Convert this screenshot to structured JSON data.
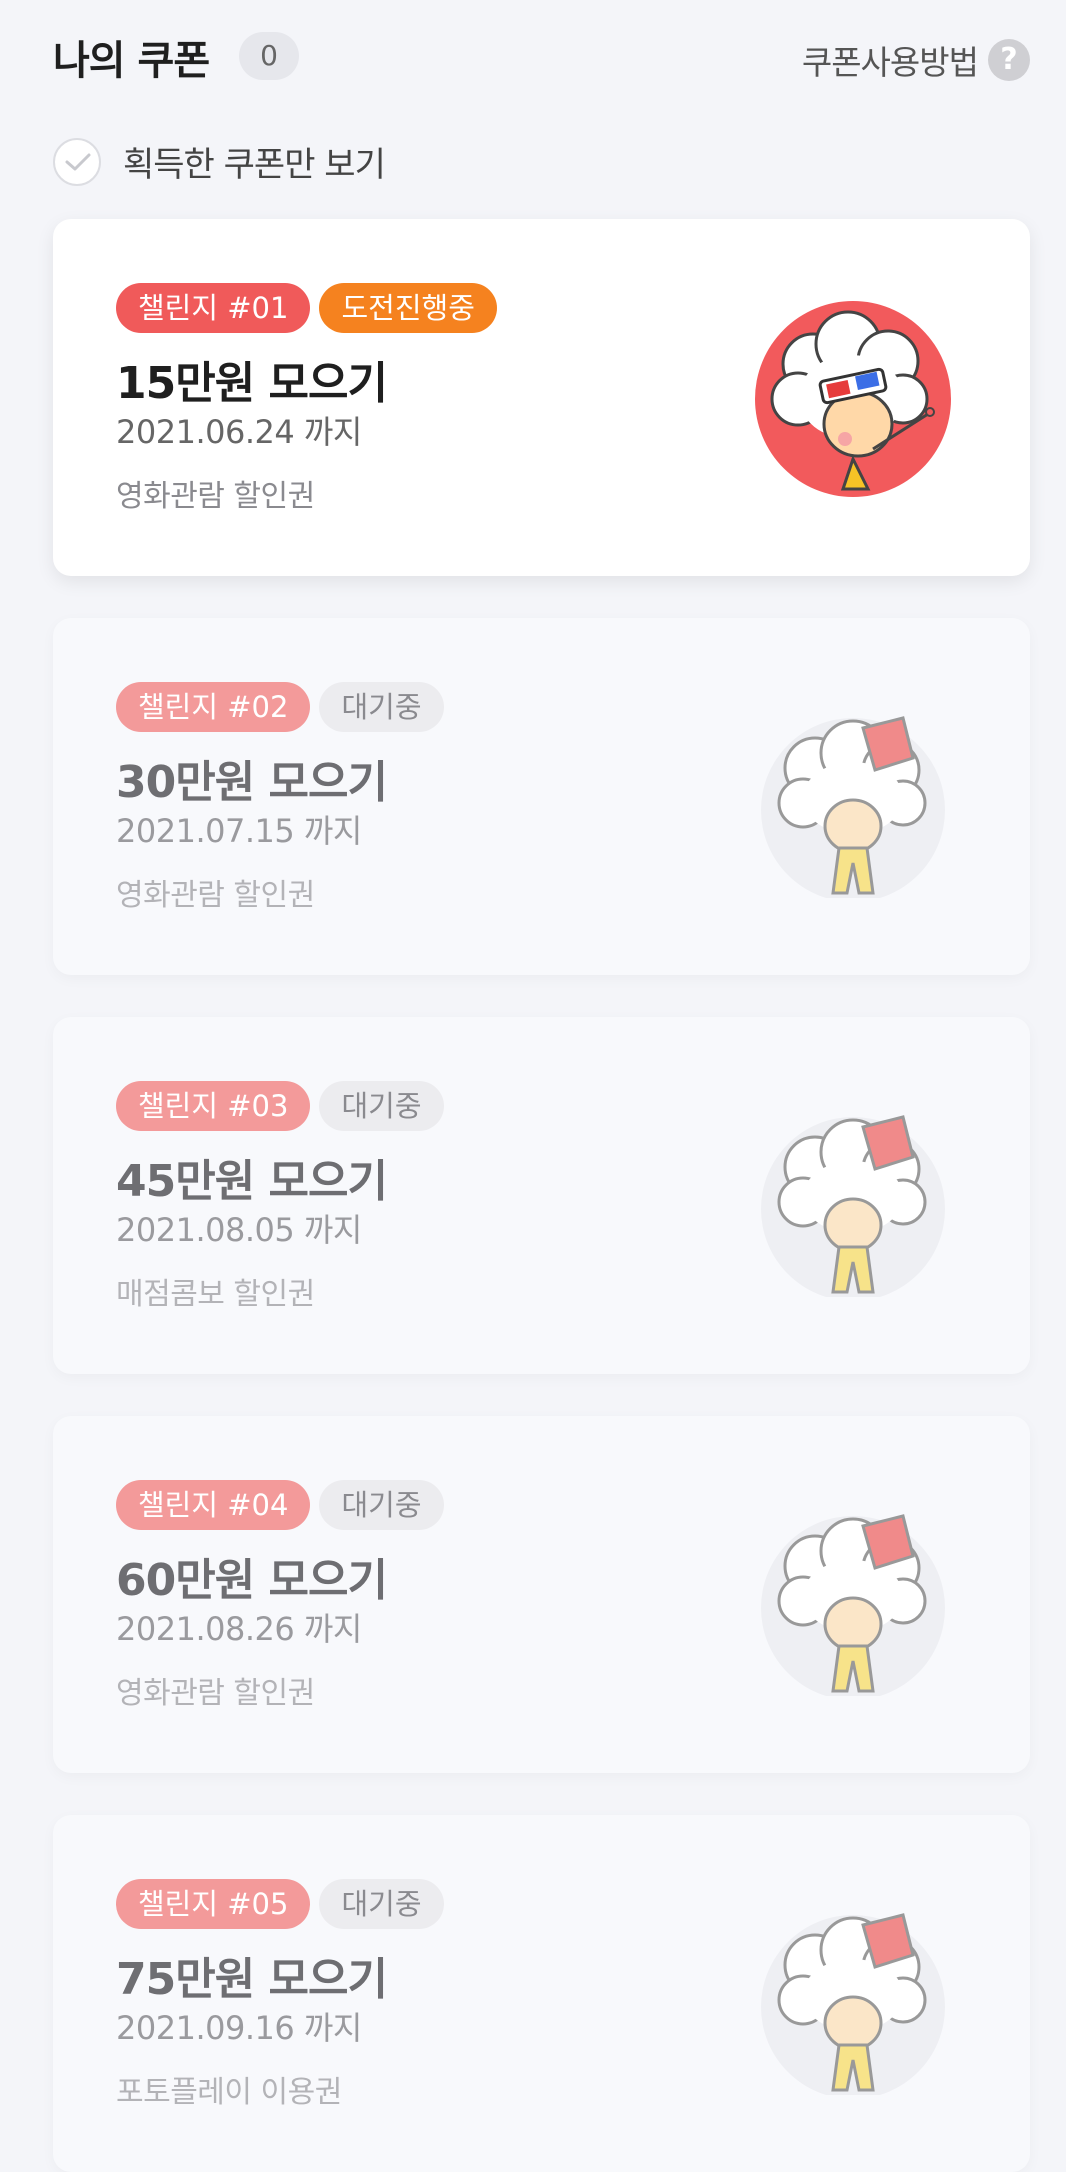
{
  "header": {
    "title": "나의 쿠폰",
    "count": "0",
    "help_label": "쿠폰사용방법",
    "help_icon": "?"
  },
  "filter": {
    "label": "획득한 쿠폰만 보기",
    "checked": false
  },
  "coupons": [
    {
      "challenge": "챌린지 #01",
      "status": "도전진행중",
      "title": "15만원 모으기",
      "date": "2021.06.24 까지",
      "type": "영화관람 할인권",
      "state": "active"
    },
    {
      "challenge": "챌린지 #02",
      "status": "대기중",
      "title": "30만원 모으기",
      "date": "2021.07.15 까지",
      "type": "영화관람 할인권",
      "state": "waiting"
    },
    {
      "challenge": "챌린지 #03",
      "status": "대기중",
      "title": "45만원 모으기",
      "date": "2021.08.05 까지",
      "type": "매점콤보 할인권",
      "state": "waiting"
    },
    {
      "challenge": "챌린지 #04",
      "status": "대기중",
      "title": "60만원 모으기",
      "date": "2021.08.26 까지",
      "type": "영화관람 할인권",
      "state": "waiting"
    },
    {
      "challenge": "챌린지 #05",
      "status": "대기중",
      "title": "75만원 모으기",
      "date": "2021.09.16 까지",
      "type": "포토플레이 이용권",
      "state": "waiting"
    }
  ],
  "colors": {
    "challenge_active": "#f05a5a",
    "challenge_waiting": "#f39a9a",
    "status_active": "#f5821f",
    "background": "#f4f5f9"
  }
}
